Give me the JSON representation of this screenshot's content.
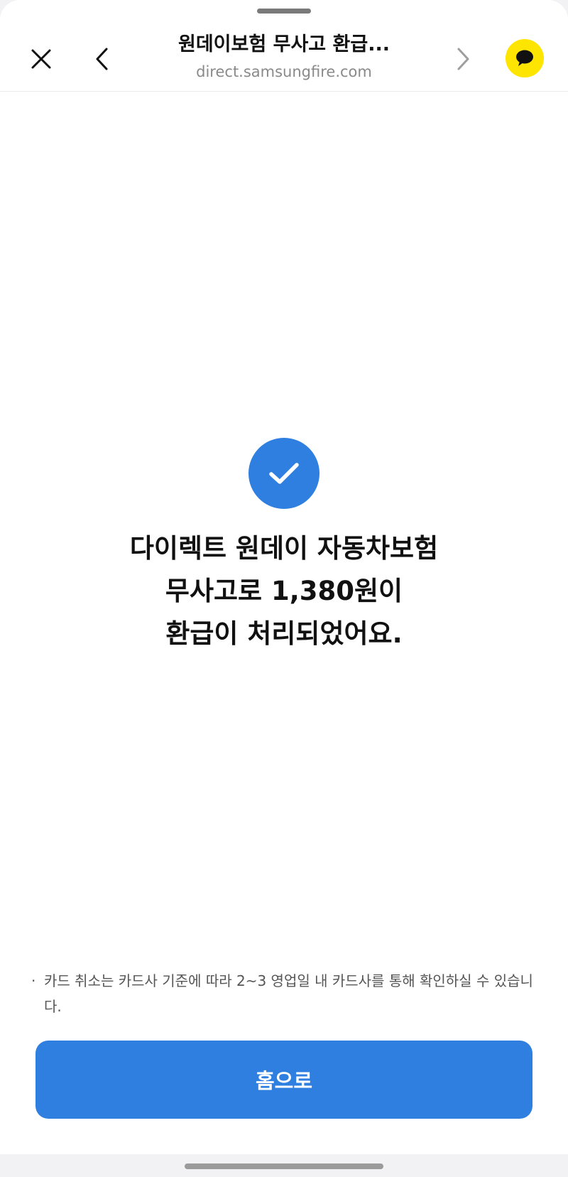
{
  "browser": {
    "title": "원데이보험 무사고 환급...",
    "url": "direct.samsungfire.com",
    "icons": {
      "close": "close-icon",
      "back": "chevron-left-icon",
      "forward": "chevron-right-icon",
      "chat": "kakaotalk-speech-bubble-icon"
    }
  },
  "result": {
    "icon": "check-icon",
    "line1": "다이렉트 원데이 자동차보험",
    "line2": "무사고로 1,380원이",
    "line3": "환급이 처리되었어요."
  },
  "notice": {
    "bullet": "·",
    "text": "카드 취소는 카드사 기준에 따라 2~3 영업일 내 카드사를 통해 확인하실 수 있습니다."
  },
  "actions": {
    "home_label": "홈으로"
  },
  "colors": {
    "accent": "#2f7fe0",
    "kakao": "#fee500",
    "text": "#111111",
    "muted": "#8a8a8a"
  }
}
